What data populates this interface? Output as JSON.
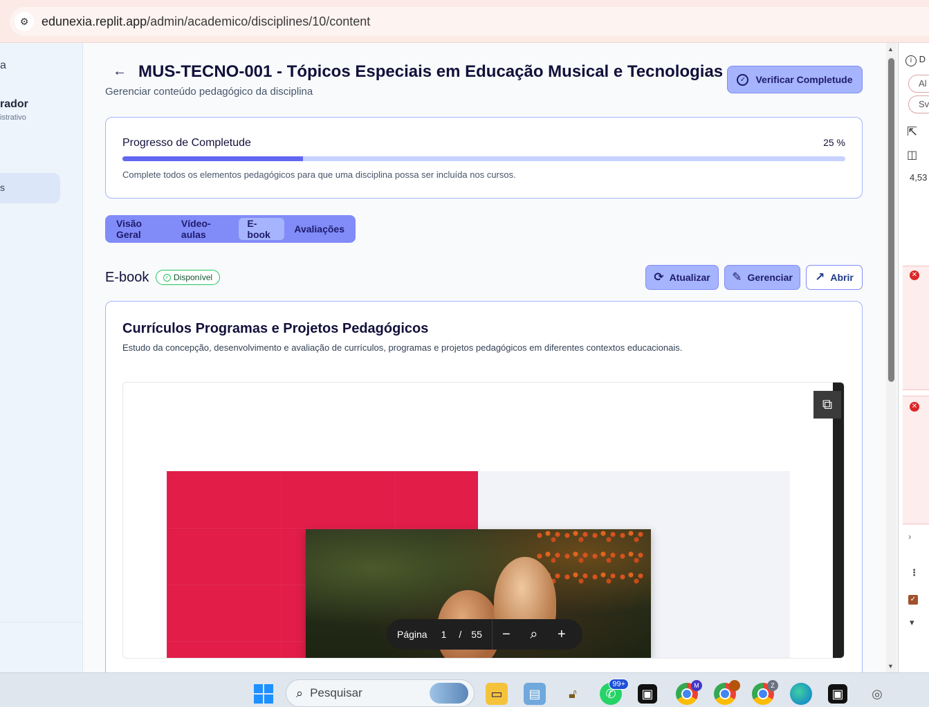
{
  "browser": {
    "url_host": "edunexia.replit.app",
    "url_path": "/admin/academico/disciplines/10/content"
  },
  "sidebar": {
    "logo_fragment": "a",
    "user_name_fragment": "rador",
    "user_role_fragment": "istrativo",
    "active_item_fragment": "s"
  },
  "header": {
    "title": "MUS-TECNO-001 - Tópicos Especiais em Educação Musical e Tecnologias",
    "subtitle": "Gerenciar conteúdo pedagógico da disciplina",
    "verify_button": "Verificar Completude"
  },
  "progress": {
    "label": "Progresso de Completude",
    "value_text": "25 %",
    "value": 0.25,
    "hint": "Complete todos os elementos pedagógicos para que uma disciplina possa ser incluída nos cursos."
  },
  "tabs": [
    {
      "label": "Visão Geral",
      "active": false
    },
    {
      "label": "Vídeo-aulas",
      "active": false
    },
    {
      "label": "E-book",
      "active": true
    },
    {
      "label": "Avaliações",
      "active": false
    }
  ],
  "ebook": {
    "section_title": "E-book",
    "status_badge": "Disponível",
    "refresh_button": "Atualizar",
    "manage_button": "Gerenciar",
    "open_button": "Abrir",
    "book_title": "Currículos Programas e Projetos Pedagógicos",
    "book_description": "Estudo da concepção, desenvolvimento e avaliação de currículos, programas e projetos pedagógicos em diferentes contextos educacionais.",
    "viewer": {
      "page_label": "Página",
      "current_page": "1",
      "separator": "/",
      "total_pages": "55"
    }
  },
  "devtools": {
    "pill_1": "Al",
    "pill_2": "Sv",
    "count": "4,53",
    "letter": "D"
  },
  "taskbar": {
    "search_placeholder": "Pesquisar",
    "whatsapp_badge": "99+",
    "chrome_profile_1": "M",
    "chrome_profile_3": "Z"
  },
  "colors": {
    "accent": "#818cf8",
    "accent_light": "#a5b4fc",
    "progress_fill": "#6366f1",
    "success": "#22c55e",
    "cover_red": "#e11d48"
  }
}
